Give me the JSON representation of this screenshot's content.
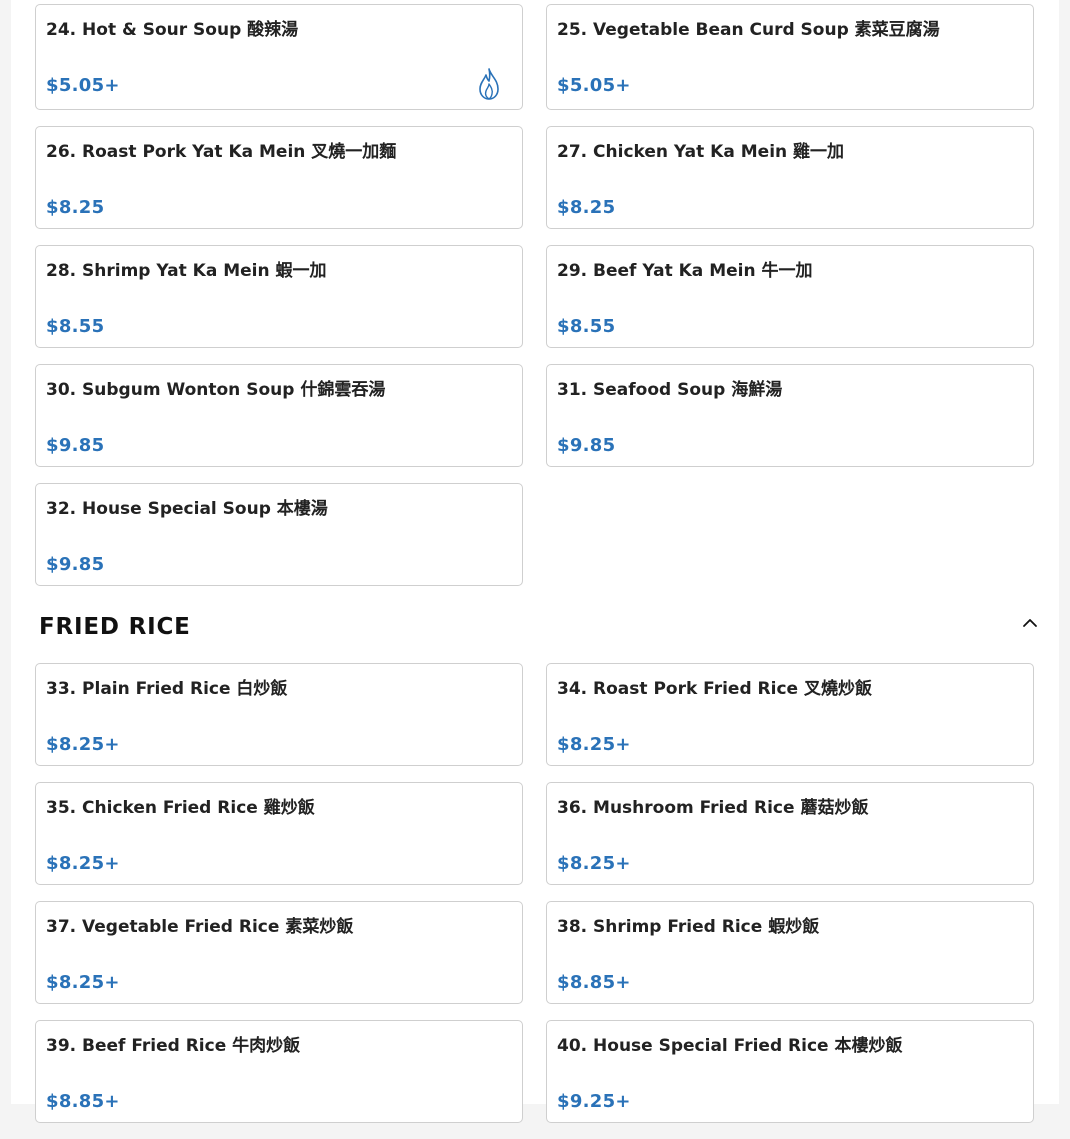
{
  "soup_items": [
    {
      "name": "24. Hot & Sour Soup 酸辣湯",
      "price": "$5.05+",
      "spicy": true
    },
    {
      "name": "25. Vegetable Bean Curd Soup 素菜豆腐湯",
      "price": "$5.05+",
      "spicy": false
    },
    {
      "name": "26. Roast Pork Yat Ka Mein 叉燒一加麵",
      "price": "$8.25",
      "spicy": false
    },
    {
      "name": "27. Chicken Yat Ka Mein 雞一加",
      "price": "$8.25",
      "spicy": false
    },
    {
      "name": "28. Shrimp Yat Ka Mein 蝦一加",
      "price": "$8.55",
      "spicy": false
    },
    {
      "name": "29. Beef Yat Ka Mein 牛一加",
      "price": "$8.55",
      "spicy": false
    },
    {
      "name": "30. Subgum Wonton Soup 什錦雲吞湯",
      "price": "$9.85",
      "spicy": false
    },
    {
      "name": "31. Seafood Soup 海鮮湯",
      "price": "$9.85",
      "spicy": false
    },
    {
      "name": "32. House Special Soup 本樓湯",
      "price": "$9.85",
      "spicy": false
    }
  ],
  "section": {
    "title": "FRIED RICE",
    "collapse_icon": "chevron-up-icon"
  },
  "rice_items": [
    {
      "name": "33. Plain Fried Rice 白炒飯",
      "price": "$8.25+"
    },
    {
      "name": "34. Roast Pork Fried Rice 叉燒炒飯",
      "price": "$8.25+"
    },
    {
      "name": "35. Chicken Fried Rice 雞炒飯",
      "price": "$8.25+"
    },
    {
      "name": "36. Mushroom Fried Rice 蘑菇炒飯",
      "price": "$8.25+"
    },
    {
      "name": "37. Vegetable Fried Rice 素菜炒飯",
      "price": "$8.25+"
    },
    {
      "name": "38. Shrimp Fried Rice 蝦炒飯",
      "price": "$8.85+"
    },
    {
      "name": "39. Beef Fried Rice 牛肉炒飯",
      "price": "$8.85+"
    },
    {
      "name": "40. House Special Fried Rice 本樓炒飯",
      "price": "$9.25+"
    }
  ],
  "colors": {
    "price": "#2a72b8",
    "spicy_icon": "#2a72b8",
    "card_border": "#cfcfcf"
  }
}
